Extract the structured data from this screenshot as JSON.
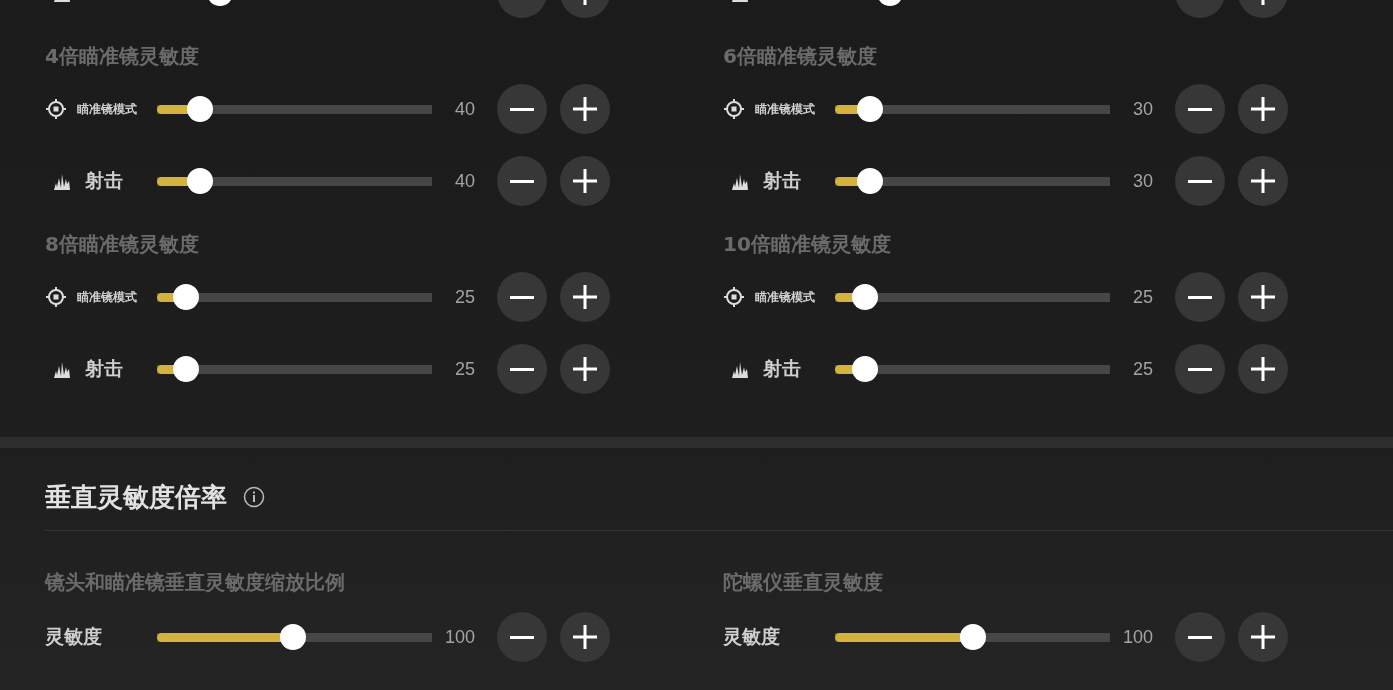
{
  "columns": [
    {
      "partial_row": {
        "kind": "shoot",
        "level": 0.23
      },
      "groups": [
        {
          "title": "4倍瞄准镜灵敏度",
          "rows": [
            {
              "kind": "scope",
              "label": "瞄准镜模式",
              "level": 0.156,
              "value": "40"
            },
            {
              "kind": "shoot",
              "label": "射击",
              "level": 0.156,
              "value": "40"
            }
          ]
        },
        {
          "title": "8倍瞄准镜灵敏度",
          "rows": [
            {
              "kind": "scope",
              "label": "瞄准镜模式",
              "level": 0.105,
              "value": "25"
            },
            {
              "kind": "shoot",
              "label": "射击",
              "level": 0.105,
              "value": "25"
            }
          ]
        }
      ]
    },
    {
      "partial_row": {
        "kind": "shoot",
        "level": 0.2
      },
      "groups": [
        {
          "title": "6倍瞄准镜灵敏度",
          "rows": [
            {
              "kind": "scope",
              "label": "瞄准镜模式",
              "level": 0.128,
              "value": "30"
            },
            {
              "kind": "shoot",
              "label": "射击",
              "level": 0.128,
              "value": "30"
            }
          ]
        },
        {
          "title": "10倍瞄准镜灵敏度",
          "rows": [
            {
              "kind": "scope",
              "label": "瞄准镜模式",
              "level": 0.11,
              "value": "25"
            },
            {
              "kind": "shoot",
              "label": "射击",
              "level": 0.11,
              "value": "25"
            }
          ]
        }
      ]
    }
  ],
  "vertical_section": {
    "title": "垂直灵敏度倍率",
    "groups": [
      {
        "title": "镜头和瞄准镜垂直灵敏度缩放比例",
        "rows": [
          {
            "kind": "plain",
            "label": "灵敏度",
            "level": 0.495,
            "value": "100"
          }
        ]
      },
      {
        "title": "陀螺仪垂直灵敏度",
        "rows": [
          {
            "kind": "plain",
            "label": "灵敏度",
            "level": 0.5,
            "value": "100"
          }
        ]
      }
    ]
  }
}
